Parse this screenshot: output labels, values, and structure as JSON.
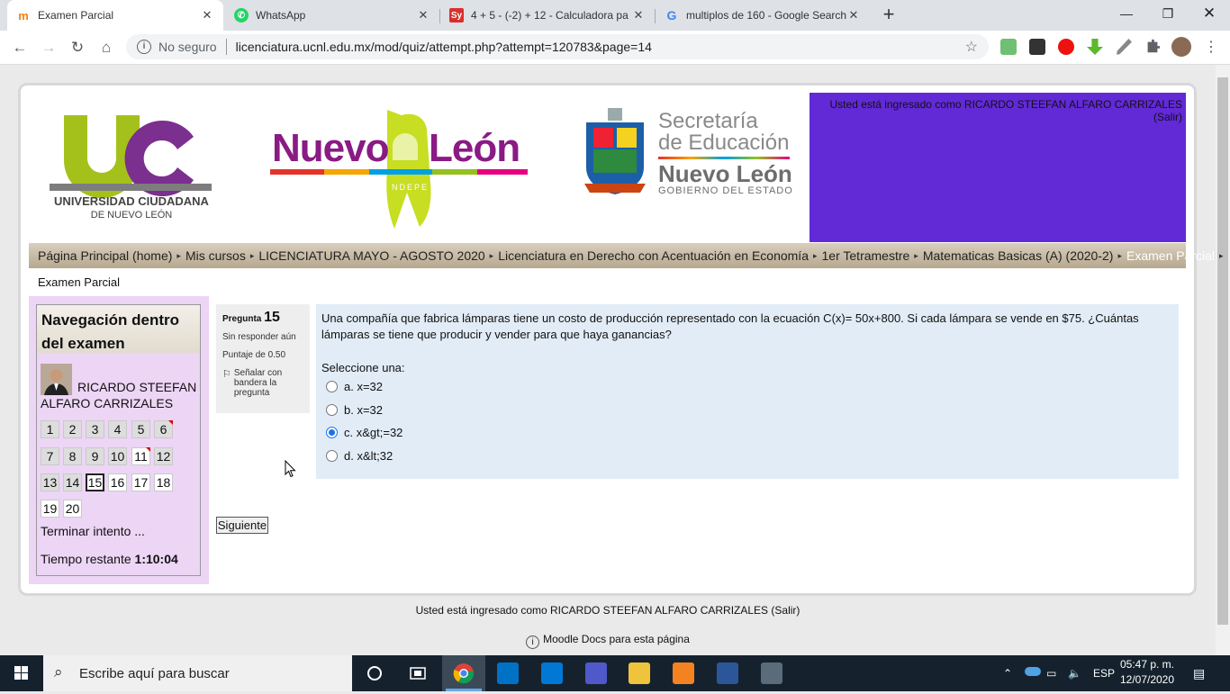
{
  "browser": {
    "tabs": [
      {
        "title": "Examen Parcial",
        "icon": "moodle-icon",
        "active": true
      },
      {
        "title": "WhatsApp",
        "icon": "whatsapp-icon",
        "active": false
      },
      {
        "title": "4 + 5 - (-2) + 12 - Calculadora pa",
        "icon": "symbolab-icon",
        "active": false
      },
      {
        "title": "multiplos de 160 - Google Search",
        "icon": "google-icon",
        "active": false
      }
    ],
    "new_tab": "+",
    "security": "No seguro",
    "url": "licenciatura.ucnl.edu.mx/mod/quiz/attempt.php?attempt=120783&page=14"
  },
  "header": {
    "login_info": "Usted está ingresado como RICARDO STEEFAN ALFARO CARRIZALES (Salir)",
    "logos": {
      "uc_letters": "UC",
      "uc_name": "UNIVERSIDAD CIUDADANA",
      "uc_sub": "DE NUEVO LEÓN",
      "nl_left": "Nuevo",
      "nl_right": "León",
      "nl_small": "NDEPE",
      "sec_line1": "Secretaría",
      "sec_line2": "de Educación",
      "sec_line3": "Nuevo León",
      "sec_line4": "GOBIERNO DEL ESTADO"
    }
  },
  "breadcrumb": {
    "items": [
      "Página Principal (home)",
      "Mis cursos",
      "LICENCIATURA MAYO - AGOSTO 2020",
      "Licenciatura en Derecho con Acentuación en Economía",
      "1er Tetramestre",
      "Matematicas Basicas (A) (2020-2)",
      "Examen Parcial"
    ],
    "separator": "▸"
  },
  "page_heading": "Examen Parcial",
  "quiz_nav": {
    "title": "Navegación dentro del examen",
    "user": "RICARDO STEEFAN ALFARO CARRIZALES",
    "questions": [
      "1",
      "2",
      "3",
      "4",
      "5",
      "6",
      "7",
      "8",
      "9",
      "10",
      "11",
      "12",
      "13",
      "14",
      "15",
      "16",
      "17",
      "18",
      "19",
      "20"
    ],
    "finish": "Terminar intento ...",
    "time_label": "Tiempo restante",
    "time_value": "1:10:04"
  },
  "question": {
    "label": "Pregunta",
    "number": "15",
    "state": "Sin responder aún",
    "mark": "Puntaje de 0.50",
    "flag": "Señalar con bandera la pregunta",
    "text": "Una compañía que fabrica lámparas tiene un costo de producción representado con la ecuación C(x)= 50x+800. Si cada lámpara se vende en $75. ¿Cuántas lámparas se tiene que producir y vender para que haya ganancias?",
    "prompt": "Seleccione una:",
    "options": [
      "a. x=32",
      "b. x=32",
      "c. x&gt;=32",
      "d. x&lt;32"
    ],
    "selected": "c. x&gt;=32"
  },
  "next_button": "Siguiente",
  "footer": {
    "login_info": "Usted está ingresado como RICARDO STEEFAN ALFARO CARRIZALES (Salir)",
    "docs": "Moodle Docs para esta página"
  },
  "taskbar": {
    "search_placeholder": "Escribe aquí para buscar",
    "language": "ESP",
    "time": "05:47 p. m.",
    "date": "12/07/2020"
  },
  "colors": {
    "header_purple": "#6229d6",
    "nav_block": "#ecd5f5",
    "question_box": "#e1ecf7",
    "uc_green": "#a4c11b",
    "uc_purple": "#7b2f8e"
  }
}
